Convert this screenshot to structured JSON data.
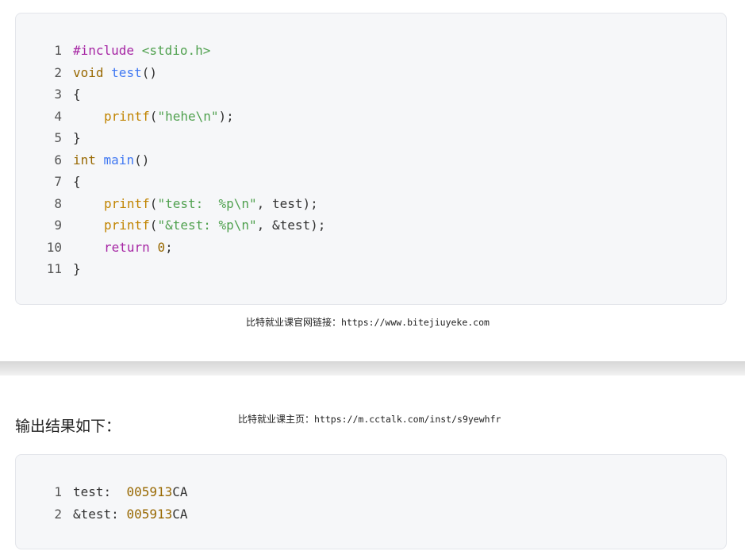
{
  "top_code": {
    "lines": [
      {
        "n": "1"
      },
      {
        "n": "2"
      },
      {
        "n": "3"
      },
      {
        "n": "4"
      },
      {
        "n": "5"
      },
      {
        "n": "6"
      },
      {
        "n": "7"
      },
      {
        "n": "8"
      },
      {
        "n": "9"
      },
      {
        "n": "10"
      },
      {
        "n": "11"
      }
    ],
    "tokens": {
      "l1_pre": "#include",
      "l1_hdr": "<stdio.h>",
      "l2_ty": "void",
      "l2_fn": "test",
      "l2_rest": "()",
      "l3": "{",
      "l4_call": "printf",
      "l4_open": "(",
      "l4_str": "\"hehe\\n\"",
      "l4_close": ");",
      "l5": "}",
      "l6_ty": "int",
      "l6_fn": "main",
      "l6_rest": "()",
      "l7": "{",
      "l8_call": "printf",
      "l8_open": "(",
      "l8_str": "\"test:  %p\\n\"",
      "l8_rest": ", test);",
      "l9_call": "printf",
      "l9_open": "(",
      "l9_str": "\"&test: %p\\n\"",
      "l9_rest": ", &test);",
      "l10_kw": "return",
      "l10_num": "0",
      "l10_end": ";",
      "l11": "}"
    }
  },
  "watermark_1": {
    "label": "比特就业课官网链接：",
    "url": "https://www.bitejiuyeke.com"
  },
  "heading": "输出结果如下：",
  "watermark_2": {
    "label": "比特就业课主页：",
    "url": "https://m.cctalk.com/inst/s9yewhfr"
  },
  "output_code": {
    "lines": [
      {
        "n": "1",
        "label": "test:  ",
        "num": "005913",
        "suffix": "CA"
      },
      {
        "n": "2",
        "label": "&test: ",
        "num": "005913",
        "suffix": "CA"
      }
    ]
  },
  "colors": {
    "keyword": "#a626a4",
    "string": "#50a14f",
    "function": "#4078f2",
    "call": "#c18401",
    "type": "#986801",
    "background": "#f6f7f9"
  }
}
